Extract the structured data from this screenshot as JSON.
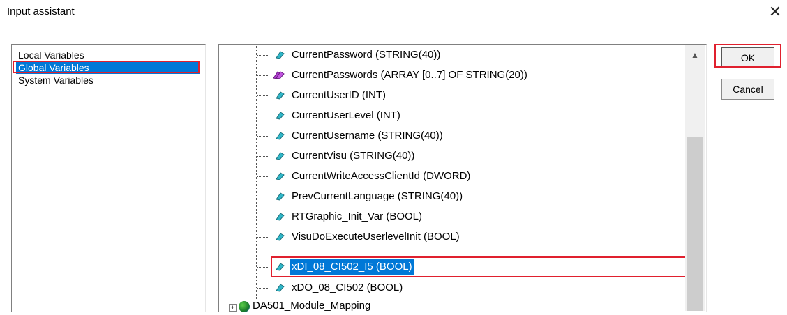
{
  "window": {
    "title": "Input assistant",
    "close_glyph": "✕"
  },
  "categories": [
    {
      "label": "Local Variables",
      "selected": false
    },
    {
      "label": "Global Variables",
      "selected": true
    },
    {
      "label": "System Variables",
      "selected": false
    }
  ],
  "tree": {
    "items": [
      {
        "label": "CurrentPassword (STRING(40))",
        "icon": "variable-icon",
        "selected": false
      },
      {
        "label": "CurrentPasswords (ARRAY [0..7] OF STRING(20))",
        "icon": "array-variable-icon",
        "selected": false
      },
      {
        "label": "CurrentUserID (INT)",
        "icon": "variable-icon",
        "selected": false
      },
      {
        "label": "CurrentUserLevel (INT)",
        "icon": "variable-icon",
        "selected": false
      },
      {
        "label": "CurrentUsername (STRING(40))",
        "icon": "variable-icon",
        "selected": false
      },
      {
        "label": "CurrentVisu (STRING(40))",
        "icon": "variable-icon",
        "selected": false
      },
      {
        "label": "CurrentWriteAccessClientId (DWORD)",
        "icon": "variable-icon",
        "selected": false
      },
      {
        "label": "PrevCurrentLanguage (STRING(40))",
        "icon": "variable-icon",
        "selected": false
      },
      {
        "label": "RTGraphic_Init_Var (BOOL)",
        "icon": "variable-icon",
        "selected": false
      },
      {
        "label": "VisuDoExecuteUserlevelInit (BOOL)",
        "icon": "variable-icon",
        "selected": false
      },
      {
        "label": "xDI_08_CI502_I5 (BOOL)",
        "icon": "variable-icon",
        "selected": true
      },
      {
        "label": "xDO_08_CI502 (BOOL)",
        "icon": "variable-icon",
        "selected": false
      }
    ],
    "folder": {
      "label": "DA501_Module_Mapping",
      "icon": "globe-icon",
      "expander": "+"
    }
  },
  "buttons": {
    "ok_label": "OK",
    "cancel_label": "Cancel"
  },
  "scrollbar": {
    "up_glyph": "▲"
  },
  "colors": {
    "selection": "#0078d7",
    "highlight_outline": "#e0202e",
    "variable_icon": "#2fb6c8",
    "array_icon": "#b03ad0"
  }
}
